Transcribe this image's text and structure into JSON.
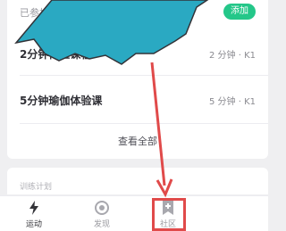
{
  "course_card": {
    "header_label": "已参加",
    "add_button_label": "添加",
    "courses": [
      {
        "title": "2分钟体验课程",
        "meta": "2 分钟 · K1"
      },
      {
        "title": "5分钟瑜伽体验课",
        "meta": "5 分钟 · K1"
      }
    ],
    "view_all_label": "查看全部"
  },
  "section": {
    "title": "训练计划"
  },
  "tabbar": {
    "tabs": [
      {
        "label": "运动",
        "icon": "lightning-icon",
        "active": true
      },
      {
        "label": "发现",
        "icon": "target-icon",
        "active": false
      },
      {
        "label": "社区",
        "icon": "bookmark-plus-icon",
        "active": false
      }
    ]
  },
  "annotation": {
    "highlight_color": "#e04a4a",
    "umbrella_color": "#2aa9c2"
  }
}
